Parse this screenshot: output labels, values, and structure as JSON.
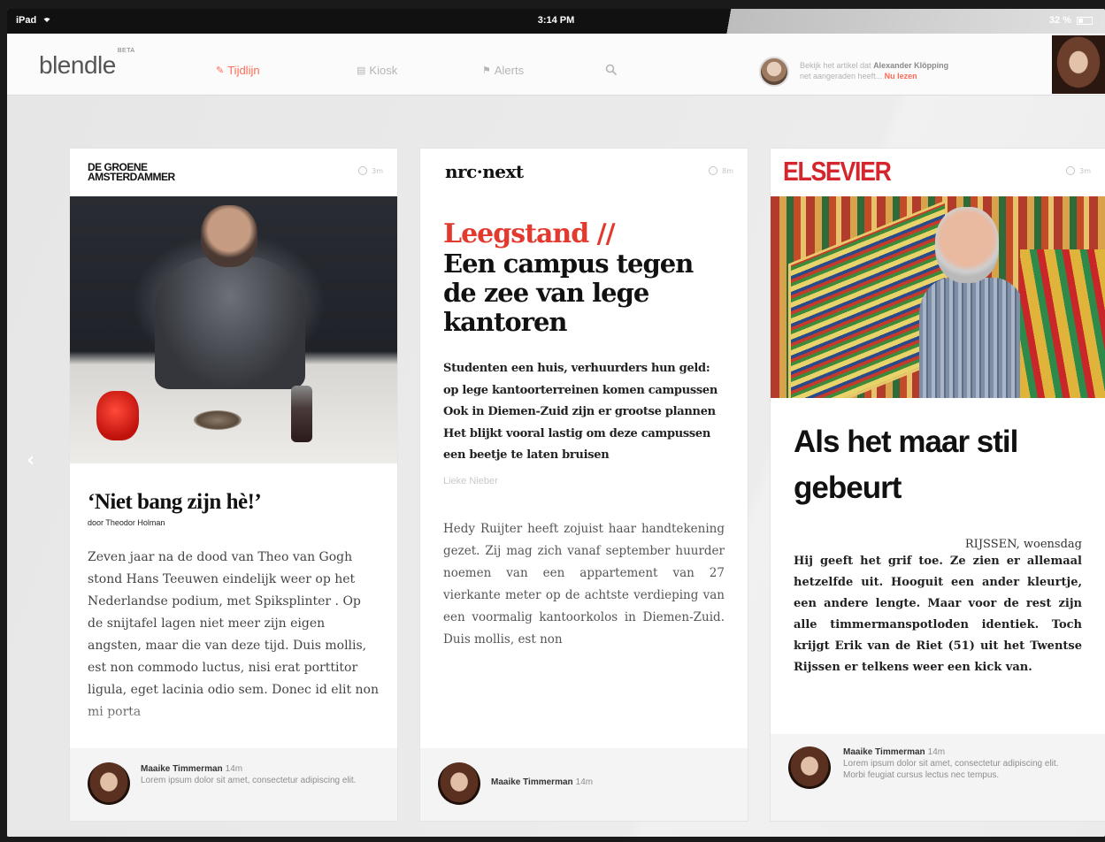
{
  "status_bar": {
    "device": "iPad",
    "time": "3:14 PM",
    "battery": "32 %"
  },
  "nav": {
    "logo": "blendle",
    "logo_badge": "BETA",
    "items": [
      {
        "label": "Tijdlijn",
        "icon": "pencil-icon",
        "active": true
      },
      {
        "label": "Kiosk",
        "icon": "newspaper-icon",
        "active": false
      },
      {
        "label": "Alerts",
        "icon": "flag-icon",
        "active": false
      }
    ],
    "notification": {
      "text_before": "Bekijk het artikel dat",
      "name": "Alexander Klöpping",
      "text_after": "net aangeraden heeft...",
      "action": "Nu lezen"
    }
  },
  "cards": [
    {
      "publication": "DE GROENE AMSTERDAMMER",
      "pub_line1": "DE GROENE",
      "pub_line2": "AMSTERDAMMER",
      "time": "3m",
      "title": "‘Niet bang zijn hè!’",
      "author": "door Theodor Holman",
      "body": "Zeven jaar na de dood van Theo van Gogh stond Hans Teeuwen eindelijk weer op het Nederlandse podium, met Spiksplinter . Op de snijtafel lagen niet meer zijn eigen angsten, maar die van deze tijd. Duis mollis, est non commodo luctus, nisi erat porttitor ligula, eget lacinia odio sem. Donec id elit non mi porta",
      "comment": {
        "name": "Maaike Timmerman",
        "time": "14m",
        "text": "Lorem ipsum dolor sit amet, consectetur adipiscing elit."
      }
    },
    {
      "publication": "nrc·next",
      "time": "8m",
      "kicker": "Leegstand //",
      "title": "Een campus tegen de zee van lege kantoren",
      "lead": "Studenten een huis, verhuurders hun geld: op lege kantoorterreinen komen campussen Ook in Diemen-Zuid zijn er grootse plannen Het blijkt vooral lastig om deze campussen een beetje te laten bruisen",
      "byline": "Lieke Nieber",
      "body": "Hedy Ruijter heeft zojuist haar handtekening gezet. Zij mag zich vanaf september huurder noemen van een appartement van 27 vierkante meter op de achtste verdieping van een voormalig kantoorkolos in Diemen-Zuid. Duis mollis, est non",
      "comment": {
        "name": "Maaike Timmerman",
        "time": "14m"
      }
    },
    {
      "publication": "ELSEVIER",
      "time": "3m",
      "title": "Als het maar stil gebeurt",
      "dateline": "RIJSSEN, woensdag",
      "body": "Hij geeft het grif toe. Ze zien er allemaal hetzelfde uit. Hooguit een ander kleurtje, een andere lengte. Maar voor de rest zijn alle timmermanspotloden identiek. Toch krijgt Erik van de Riet (51) uit het Twentse Rijssen er telkens weer een kick van.",
      "comment": {
        "name": "Maaike Timmerman",
        "time": "14m",
        "text": "Lorem ipsum dolor sit amet, consectetur adipiscing elit. Morbi feugiat cursus lectus nec tempus."
      }
    }
  ],
  "colors": {
    "accent": "#ff6a55",
    "elsevier_red": "#d6262d",
    "nrc_kicker": "#e23a2e"
  }
}
